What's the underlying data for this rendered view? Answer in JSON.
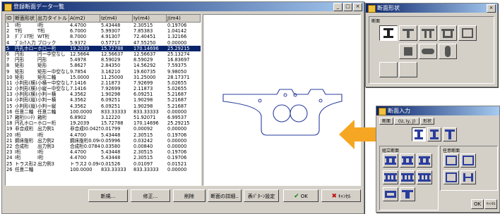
{
  "main_window": {
    "title": "登録断面データ一覧",
    "title_buttons": [
      "_",
      "□",
      "×"
    ],
    "columns": [
      "ID",
      "断面形状",
      "出力タイトル",
      "A(m2)",
      "Iz(m4)",
      "Iy(m4)",
      "J(m4)"
    ],
    "rows": [
      [
        "1",
        "I桁",
        "I桁",
        "4.4700",
        "5.43448",
        "2.30515",
        "0.19706"
      ],
      [
        "2",
        "T桁",
        "T桁",
        "6.7000",
        "5.99307",
        "7.85383",
        "1.04142"
      ],
      [
        "3",
        "ﾀﾞﾌﾞﾙT桁",
        "WT桁",
        "8.7000",
        "4.91307",
        "72.40451",
        "1.32166"
      ],
      [
        "4",
        "ﾌﾞﾛｯｸ入力",
        "ブロック",
        "5.9372",
        "0.57717",
        "47.55250",
        "0.00000"
      ],
      [
        "5",
        "円孔ホロー桁",
        "ホロー桁",
        "19.2039",
        "15.72788",
        "170.14696",
        "25.29215"
      ],
      [
        "6",
        "円形",
        "円ー中空なし",
        "12.5664",
        "12.56637",
        "12.56637",
        "25.13274"
      ],
      [
        "7",
        "円形",
        "円形",
        "5.4978",
        "8.59029",
        "8.59029",
        "16.83697"
      ],
      [
        "8",
        "矩形",
        "矩形",
        "5.8627",
        "2.84350",
        "14.56292",
        "7.59375"
      ],
      [
        "9",
        "矩形",
        "矩形ー中空なし",
        "9.7854",
        "3.16210",
        "19.60735",
        "9.98050"
      ],
      [
        "10",
        "矩形",
        "矩形二軸",
        "15.0000",
        "11.25000",
        "31.25000",
        "28.17371"
      ],
      [
        "11",
        "小判形(横)",
        "小横ー中空なし",
        "7.1416",
        "2.11873",
        "7.92699",
        "5.02655"
      ],
      [
        "12",
        "小判形(横)",
        "小縦ー中空なし",
        "7.1416",
        "7.92699",
        "2.11873",
        "5.02655"
      ],
      [
        "13",
        "小判形(横)",
        "小判ー横",
        "4.3562",
        "1.90298",
        "6.09251",
        "5.21687"
      ],
      [
        "14",
        "小判形(縦)",
        "小判ー横",
        "4.3562",
        "6.09251",
        "1.90298",
        "5.21687"
      ],
      [
        "15",
        "小判形(縦)",
        "小判ー縦",
        "4.3562",
        "6.09251",
        "1.90298",
        "5.21687"
      ],
      [
        "16",
        "任意二軸",
        "任意二軸",
        "100.0000",
        "833.33333",
        "833.33333",
        "0.00000"
      ],
      [
        "17",
        "箱桁(ﾊﾝﾁ)",
        "箱桁",
        "6.8902",
        "3.12220",
        "51.92071",
        "6.99537"
      ],
      [
        "18",
        "円孔ホロー桁",
        "ホロー桁",
        "19.2039",
        "15.72788",
        "170.14696",
        "25.29215"
      ],
      [
        "19",
        "非合成桁",
        "出力例1",
        "非合成I0.0425",
        "0.01799",
        "0.00092",
        "0.00000"
      ],
      [
        "20",
        "I桁",
        "I桁",
        "4.4700",
        "5.43448",
        "2.30515",
        "0.19706"
      ],
      [
        "21",
        "鋼床版桁",
        "出力例2",
        "鋼床版桁0.0949",
        "0.05996",
        "0.03242",
        "0.00000"
      ],
      [
        "22",
        "合成桁",
        "出力例3",
        "合成桁0.0784",
        "0.03580",
        "0.00840",
        "0.00000"
      ],
      [
        "23",
        "I桁",
        "I桁",
        "4.4700",
        "5.43448",
        "2.30515",
        "0.19706"
      ],
      [
        "24",
        "I桁",
        "I桁",
        "4.4700",
        "5.43448",
        "2.30515",
        "0.19706"
      ],
      [
        "25",
        "トラス形2",
        "出力例3",
        "トラス2 0.0944",
        "0.01526",
        "0.01097",
        "0.01521"
      ],
      [
        "26",
        "任意二軸",
        "",
        "100.0000",
        "833.33333",
        "833.33333",
        "0.00000"
      ]
    ],
    "selected_row": 4,
    "buttons": {
      "new": "新規...",
      "edit": "修正...",
      "delete": "削除",
      "detail": "断面の詳細..",
      "pattern": "表ﾊﾟﾀｰﾝ設定",
      "ok": "OK",
      "cancel": "ｷｬﾝｾﾙ"
    }
  },
  "shape_window_a": {
    "title": "断面形状",
    "title_buttons": [
      "×"
    ],
    "group_label": "断面"
  },
  "shape_window_b": {
    "title": "断面入力",
    "tabs": [
      "断面",
      "(Iz, Iy, J)",
      "形状"
    ],
    "group_left": "組立断面",
    "group_right": "任意断面",
    "ok": "OK",
    "cancel": "ｷｬﾝｾﾙ"
  },
  "colors": {
    "titlebar": "#0a246a",
    "selection": "#0a246a",
    "arrow": "#f5a623",
    "face": "#d4d0c8",
    "icon_blue": "#2a3d9e"
  }
}
